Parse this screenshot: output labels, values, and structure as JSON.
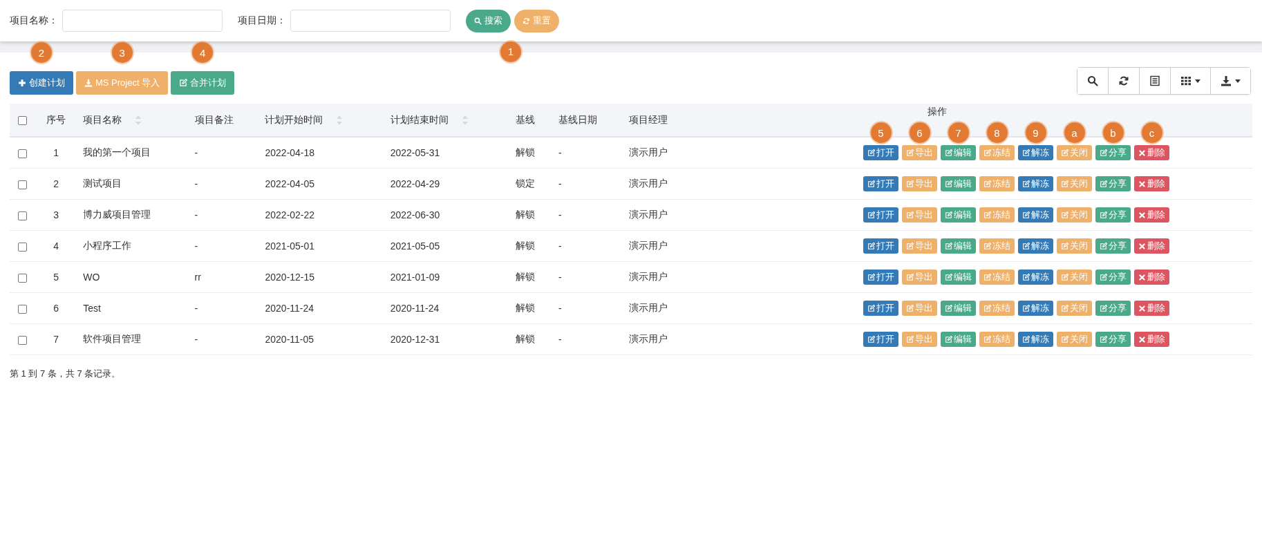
{
  "search_form": {
    "fields": [
      {
        "label": "项目名称："
      },
      {
        "label": "项目日期："
      }
    ],
    "buttons": [
      {
        "label": "搜索",
        "marker": "1"
      },
      {
        "label": "重置"
      }
    ]
  },
  "toolbar": {
    "buttons": [
      {
        "label": "创建计划",
        "marker": "2"
      },
      {
        "label": "MS Project 导入",
        "marker": "3"
      },
      {
        "label": "合并计划",
        "marker": "4"
      }
    ]
  },
  "table": {
    "header_checked": false,
    "columns": [
      {
        "label": "序号",
        "sortable": false
      },
      {
        "label": "项目名称",
        "sortable": true
      },
      {
        "label": "项目备注",
        "sortable": false
      },
      {
        "label": "计划开始时间",
        "sortable": true
      },
      {
        "label": "计划结束时间",
        "sortable": true
      },
      {
        "label": "基线",
        "sortable": false
      },
      {
        "label": "基线日期",
        "sortable": false
      },
      {
        "label": "项目经理",
        "sortable": false
      },
      {
        "label": "操作",
        "sortable": false
      }
    ],
    "rows": [
      {
        "checked": false,
        "cells": [
          "1",
          "我的第一个项目",
          "-",
          "2022-04-18",
          "2022-05-31",
          "解锁",
          "-",
          "演示用户"
        ],
        "actions": [
          {
            "label": "打开",
            "marker": "5"
          },
          {
            "label": "导出",
            "marker": "6"
          },
          {
            "label": "编辑",
            "marker": "7"
          },
          {
            "label": "冻结",
            "marker": "8"
          },
          {
            "label": "解冻",
            "marker": "9"
          },
          {
            "label": "关闭",
            "marker": "a"
          },
          {
            "label": "分享",
            "marker": "b"
          },
          {
            "label": "删除",
            "marker": "c"
          }
        ]
      },
      {
        "checked": false,
        "cells": [
          "2",
          "测试项目",
          "-",
          "2022-04-05",
          "2022-04-29",
          "锁定",
          "-",
          "演示用户"
        ],
        "actions": [
          {
            "label": "打开"
          },
          {
            "label": "导出"
          },
          {
            "label": "编辑"
          },
          {
            "label": "冻结"
          },
          {
            "label": "解冻"
          },
          {
            "label": "关闭"
          },
          {
            "label": "分享"
          },
          {
            "label": "删除"
          }
        ]
      },
      {
        "checked": false,
        "cells": [
          "3",
          "博力威项目管理",
          "-",
          "2022-02-22",
          "2022-06-30",
          "解锁",
          "-",
          "演示用户"
        ],
        "actions": [
          {
            "label": "打开"
          },
          {
            "label": "导出"
          },
          {
            "label": "编辑"
          },
          {
            "label": "冻结"
          },
          {
            "label": "解冻"
          },
          {
            "label": "关闭"
          },
          {
            "label": "分享"
          },
          {
            "label": "删除"
          }
        ]
      },
      {
        "checked": false,
        "cells": [
          "4",
          "小程序工作",
          "-",
          "2021-05-01",
          "2021-05-05",
          "解锁",
          "-",
          "演示用户"
        ],
        "actions": [
          {
            "label": "打开"
          },
          {
            "label": "导出"
          },
          {
            "label": "编辑"
          },
          {
            "label": "冻结"
          },
          {
            "label": "解冻"
          },
          {
            "label": "关闭"
          },
          {
            "label": "分享"
          },
          {
            "label": "删除"
          }
        ]
      },
      {
        "checked": false,
        "cells": [
          "5",
          "WO",
          "rr",
          "2020-12-15",
          "2021-01-09",
          "解锁",
          "-",
          "演示用户"
        ],
        "actions": [
          {
            "label": "打开"
          },
          {
            "label": "导出"
          },
          {
            "label": "编辑"
          },
          {
            "label": "冻结"
          },
          {
            "label": "解冻"
          },
          {
            "label": "关闭"
          },
          {
            "label": "分享"
          },
          {
            "label": "删除"
          }
        ]
      },
      {
        "checked": false,
        "cells": [
          "6",
          "Test",
          "-",
          "2020-11-24",
          "2020-11-24",
          "解锁",
          "-",
          "演示用户"
        ],
        "actions": [
          {
            "label": "打开"
          },
          {
            "label": "导出"
          },
          {
            "label": "编辑"
          },
          {
            "label": "冻结"
          },
          {
            "label": "解冻"
          },
          {
            "label": "关闭"
          },
          {
            "label": "分享"
          },
          {
            "label": "删除"
          }
        ]
      },
      {
        "checked": false,
        "cells": [
          "7",
          "软件项目管理",
          "-",
          "2020-11-05",
          "2020-12-31",
          "解锁",
          "-",
          "演示用户"
        ],
        "actions": [
          {
            "label": "打开"
          },
          {
            "label": "导出"
          },
          {
            "label": "编辑"
          },
          {
            "label": "冻结"
          },
          {
            "label": "解冻"
          },
          {
            "label": "关闭"
          },
          {
            "label": "分享"
          },
          {
            "label": "删除"
          }
        ]
      }
    ]
  },
  "pagination_info": "第 1 到 7 条，共 7 条记录。"
}
